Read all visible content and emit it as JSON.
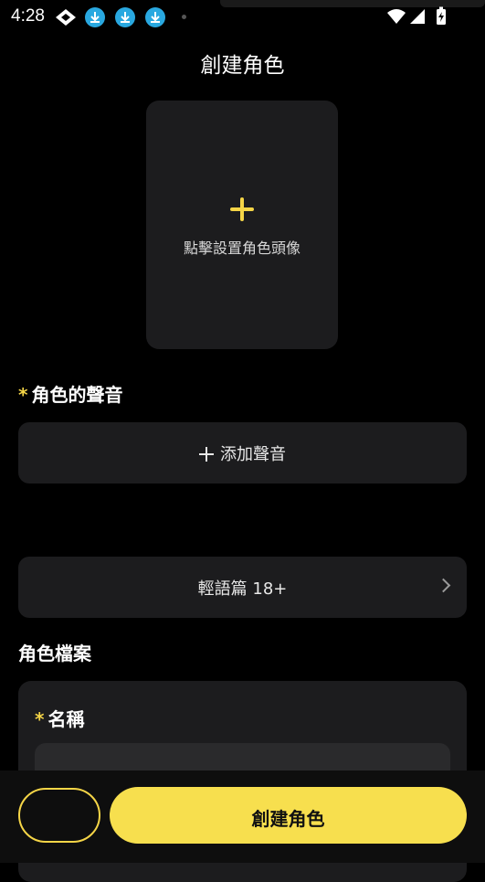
{
  "status_bar": {
    "time": "4:28",
    "icons": [
      "diamond-icon",
      "download-icon",
      "download-icon",
      "download-icon",
      "wifi-icon",
      "signal-icon",
      "battery-charging-icon"
    ]
  },
  "header": {
    "title": "創建角色"
  },
  "avatar": {
    "label": "點擊設置角色頭像",
    "icon": "plus-icon"
  },
  "voice": {
    "required_mark": "*",
    "title": "角色的聲音",
    "add_button": "添加聲音",
    "add_icon": "plus-icon"
  },
  "mode": {
    "label": "輕語篇 18+",
    "icon": "chevron-right-icon"
  },
  "profile": {
    "title": "角色檔案",
    "name_required_mark": "*",
    "name_label": "名稱",
    "name_value": ""
  },
  "footer": {
    "primary_label": "創建角色"
  },
  "colors": {
    "accent": "#f5d547",
    "background": "#000000",
    "card": "#1c1c1e",
    "download_badge": "#29a8e0"
  }
}
